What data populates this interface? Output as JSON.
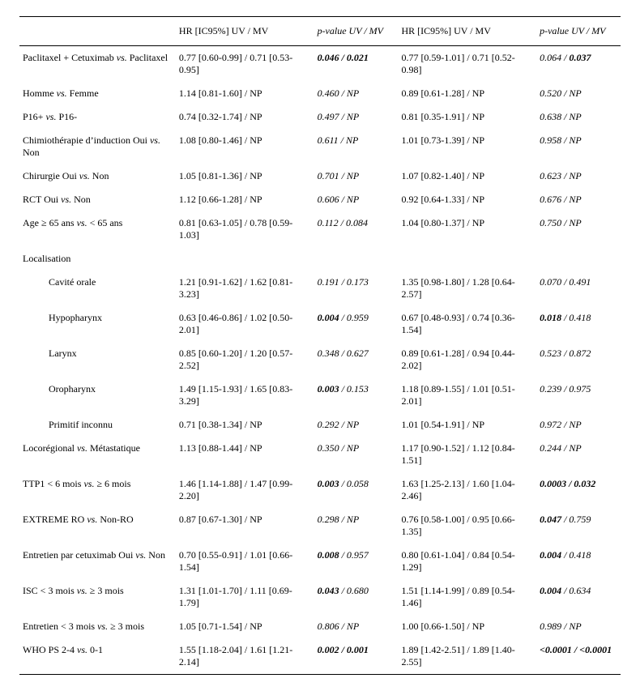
{
  "headers": {
    "blank": "",
    "hr": "HR [IC95%] UV / MV",
    "p": "p-value UV / MV"
  },
  "rows": [
    {
      "label": "Paclitaxel + Cetuximab vs. Paclitaxel",
      "indent": false,
      "hr1": "0.77 [0.60-0.99] / 0.71 [0.53-0.95]",
      "p1": "0.046 / 0.021",
      "p1b": true,
      "hr2": "0.77 [0.59-1.01] / 0.71 [0.52-0.98]",
      "p2": "0.064 / 0.037",
      "p2bpart": "0.037"
    },
    {
      "label": "Homme vs. Femme",
      "indent": false,
      "hr1": "1.14 [0.81-1.60] / NP",
      "p1": "0.460 / NP",
      "hr2": "0.89 [0.61-1.28] / NP",
      "p2": "0.520 / NP"
    },
    {
      "label": "P16+ vs. P16-",
      "indent": false,
      "hr1": "0.74 [0.32-1.74] / NP",
      "p1": "0.497 / NP",
      "hr2": "0.81 [0.35-1.91] / NP",
      "p2": "0.638 / NP"
    },
    {
      "label": "Chimiothérapie d’induction Oui vs. Non",
      "indent": false,
      "hr1": "1.08 [0.80-1.46] / NP",
      "p1": "0.611 / NP",
      "hr2": "1.01 [0.73-1.39] / NP",
      "p2": "0.958 / NP"
    },
    {
      "label": "Chirurgie Oui vs. Non",
      "indent": false,
      "hr1": "1.05 [0.81-1.36] / NP",
      "p1": "0.701 / NP",
      "hr2": "1.07 [0.82-1.40] / NP",
      "p2": "0.623 / NP"
    },
    {
      "label": "RCT Oui vs. Non",
      "indent": false,
      "hr1": "1.12 [0.66-1.28] / NP",
      "p1": "0.606 / NP",
      "hr2": "0.92 [0.64-1.33] / NP",
      "p2": "0.676 / NP"
    },
    {
      "label": "Age ≥ 65 ans vs. < 65 ans",
      "indent": false,
      "hr1": "0.81 [0.63-1.05] / 0.78 [0.59-1.03]",
      "p1": "0.112 / 0.084",
      "hr2": "1.04 [0.80-1.37] / NP",
      "p2": "0.750 / NP"
    },
    {
      "label": "Localisation",
      "indent": false,
      "section": true
    },
    {
      "label": "Cavité orale",
      "indent": true,
      "hr1": "1.21 [0.91-1.62] / 1.62 [0.81-3.23]",
      "p1": "0.191 / 0.173",
      "hr2": "1.35 [0.98-1.80] / 1.28 [0.64-2.57]",
      "p2": "0.070 / 0.491"
    },
    {
      "label": "Hypopharynx",
      "indent": true,
      "hr1": "0.63 [0.46-0.86] / 1.02 [0.50-2.01]",
      "p1": "0.004 / 0.959",
      "p1bpart": "0.004",
      "hr2": "0.67 [0.48-0.93] / 0.74 [0.36-1.54]",
      "p2": "0.018 / 0.418",
      "p2bpart": "0.018"
    },
    {
      "label": "Larynx",
      "indent": true,
      "hr1": "0.85 [0.60-1.20] / 1.20 [0.57-2.52]",
      "p1": "0.348 / 0.627",
      "hr2": "0.89 [0.61-1.28] / 0.94 [0.44-2.02]",
      "p2": "0.523 / 0.872"
    },
    {
      "label": "Oropharynx",
      "indent": true,
      "hr1": "1.49 [1.15-1.93] / 1.65 [0.83-3.29]",
      "p1": "0.003 / 0.153",
      "p1bpart": "0.003",
      "hr2": "1.18 [0.89-1.55] / 1.01 [0.51-2.01]",
      "p2": "0.239 / 0.975"
    },
    {
      "label": "Primitif inconnu",
      "indent": true,
      "hr1": "0.71 [0.38-1.34] / NP",
      "p1": "0.292 / NP",
      "hr2": "1.01 [0.54-1.91] / NP",
      "p2": "0.972 / NP"
    },
    {
      "label": "Locorégional vs. Métastatique",
      "indent": false,
      "hr1": "1.13 [0.88-1.44] / NP",
      "p1": "0.350 / NP",
      "hr2": "1.17 [0.90-1.52] / 1.12 [0.84-1.51]",
      "p2": "0.244 / NP"
    },
    {
      "label": "TTP1 < 6 mois vs. ≥ 6 mois",
      "indent": false,
      "hr1": "1.46 [1.14-1.88] / 1.47 [0.99-2.20]",
      "p1": "0.003 / 0.058",
      "p1bpart": "0.003",
      "hr2": "1.63 [1.25-2.13] / 1.60 [1.04-2.46]",
      "p2": "0.0003 / 0.032",
      "p2b": true
    },
    {
      "label": "EXTREME RO vs. Non-RO",
      "indent": false,
      "hr1": "0.87 [0.67-1.30] / NP",
      "p1": "0.298 / NP",
      "hr2": "0.76 [0.58-1.00] / 0.95 [0.66-1.35]",
      "p2": "0.047 / 0.759",
      "p2bpart": "0.047"
    },
    {
      "label": "Entretien par cetuximab Oui vs. Non",
      "indent": false,
      "hr1": "0.70 [0.55-0.91] / 1.01 [0.66-1.54]",
      "p1": "0.008 / 0.957",
      "p1bpart": "0.008",
      "hr2": "0.80 [0.61-1.04] / 0.84 [0.54-1.29]",
      "p2": "0.004 / 0.418",
      "p2bpart": "0.004"
    },
    {
      "label": "ISC < 3 mois vs. ≥ 3 mois",
      "indent": false,
      "hr1": "1.31 [1.01-1.70] / 1.11 [0.69-1.79]",
      "p1": "0.043 / 0.680",
      "p1bpart": "0.043",
      "hr2": "1.51 [1.14-1.99] / 0.89 [0.54-1.46]",
      "p2": "0.004 / 0.634",
      "p2bpart": "0.004"
    },
    {
      "label": "Entretien < 3 mois vs. ≥ 3 mois",
      "indent": false,
      "hr1": "1.05 [0.71-1.54] / NP",
      "p1": "0.806 / NP",
      "hr2": "1.00 [0.66-1.50] / NP",
      "p2": "0.989 / NP"
    },
    {
      "label": "WHO PS 2-4 vs. 0-1",
      "indent": false,
      "hr1": "1.55 [1.18-2.04] / 1.61 [1.21-2.14]",
      "p1": "0.002 / 0.001",
      "p1b": true,
      "hr2": "1.89 [1.42-2.51] / 1.89 [1.40-2.55]",
      "p2": "<0.0001 / <0.0001",
      "p2b": true
    }
  ]
}
